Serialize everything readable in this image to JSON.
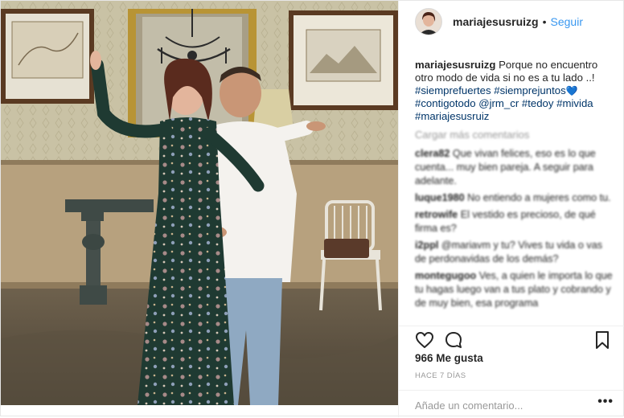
{
  "post": {
    "username": "mariajesusruizg",
    "header_dot": "•",
    "follow_label": "Seguir",
    "caption": {
      "username": "mariajesusruizg",
      "text": "Porque no encuentro otro modo de vida si no es a tu lado ..!",
      "tags": [
        "#siemprefuertes",
        "#siemprejuntos",
        "#contigotodo",
        "@jrm_cr",
        "#tedoy",
        "#mivida",
        "#mariajesusruiz"
      ],
      "heart": "💙"
    },
    "load_more": "Cargar más comentarios",
    "comments": [
      {
        "user": "clera82",
        "text": "Que vivan felices, eso es lo que cuenta... muy bien pareja. A seguir para adelante."
      },
      {
        "user": "luque1980",
        "text": "No entiendo a mujeres como tu."
      },
      {
        "user": "retrowife",
        "text": "El vestido es precioso, de qué firma es?"
      },
      {
        "user": "i2ppl",
        "text": "@mariavm y tu? Vives tu vida o vas de perdonavidas de los demás?"
      },
      {
        "user": "montegugoo",
        "text": "Ves, a quien le importa lo que tu hagas luego van a tus plato y cobrando y de muy bien, esa programa"
      }
    ],
    "likes": "966 Me gusta",
    "timestamp": "HACE 7 DÍAS",
    "comment_placeholder": "Añade un comentario...",
    "more_options": "•••"
  },
  "icons": {
    "like": "heart-outline-icon",
    "comment": "speech-bubble-icon",
    "save": "bookmark-icon"
  },
  "colors": {
    "link_blue": "#3897f0",
    "hashtag_navy": "#003569",
    "muted_gray": "#999999",
    "dress_green": "#1f3a32"
  }
}
